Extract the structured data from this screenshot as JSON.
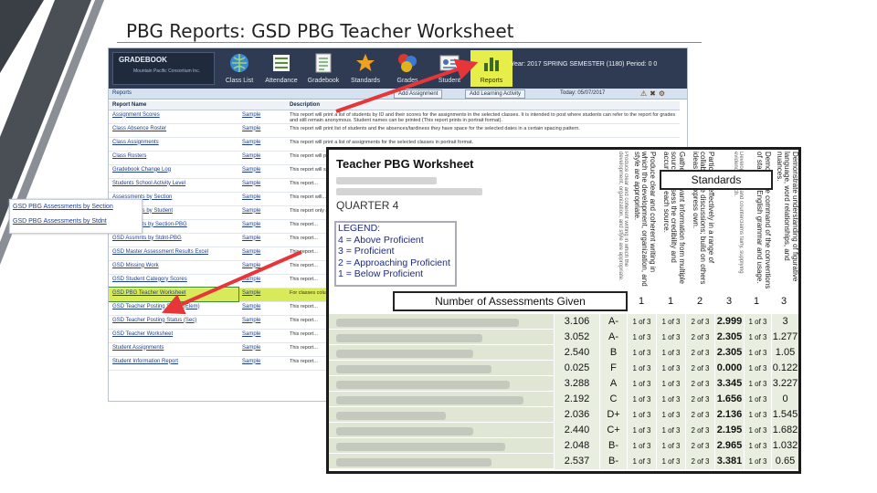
{
  "slide": {
    "title": "PBG Reports: GSD PBG Teacher Worksheet"
  },
  "colors": {
    "arrow": "#e6363a",
    "toolbar_active": "#e7ee4a",
    "row_highlight": "#d8ea5a",
    "legend_text": "#1e2b86",
    "toolbar_bg": "#2f3b52"
  },
  "gradebook": {
    "logo": "GRADEBOOK",
    "logo_sub": "Mountain Pacific\nConsortium Inc.",
    "toolbar": [
      {
        "label": "Class List",
        "icon": "globe-icon"
      },
      {
        "label": "Attendance",
        "icon": "attendance-icon"
      },
      {
        "label": "Gradebook",
        "icon": "gradebook-icon"
      },
      {
        "label": "Standards",
        "icon": "star-icon"
      },
      {
        "label": "Grades",
        "icon": "grades-icon"
      },
      {
        "label": "Student",
        "icon": "student-icon"
      },
      {
        "label": "Reports",
        "icon": "reports-icon"
      }
    ],
    "year_info": "Year: 2017 SPRING SEMESTER (1180) Period: 0 0",
    "subbar": {
      "reports_label": "Reports",
      "assignment_pill": "Add Assignment",
      "learning_pill": "Add Learning Activity",
      "date": "Today: 05/07/2017"
    },
    "table": {
      "headers": [
        "Report Name",
        "",
        "Description"
      ],
      "rows": [
        {
          "name": "Assignment Scores",
          "sample": "Sample",
          "desc": "This report will print a list of students by ID and their scores for the assignments in the selected classes. It is intended to post where students can refer to the report for grades and still remain anonymous. Student names can be printed (This report prints in portrait format)."
        },
        {
          "name": "Class Absence Roster",
          "sample": "Sample",
          "desc": "This report will print list of students and the absences/tardiness they have space for the selected dates in a certain spacing pattern."
        },
        {
          "name": "Class Assignments",
          "sample": "Sample",
          "desc": "This report will print a list of assignments for the selected classes in portrait format."
        },
        {
          "name": "Class Rosters",
          "sample": "Sample",
          "desc": "This report will print a list of students."
        },
        {
          "name": "Gradebook Change Log",
          "sample": "Sample",
          "desc": "This report will show changes (This report prints in landscape)."
        },
        {
          "name": "Students School Activity Level",
          "sample": "Sample",
          "desc": "This report..."
        },
        {
          "name": "Assessments by Section",
          "sample": "Sample",
          "desc": "This report will..."
        },
        {
          "name": "Assessments by Student",
          "sample": "Sample",
          "desc": "This report only assessment..."
        },
        {
          "name": "GSD Assmnts by Section-PBG",
          "sample": "Sample",
          "desc": "This report..."
        },
        {
          "name": "GSD Assmnts by Stdnt-PBG",
          "sample": "Sample",
          "desc": "This report..."
        },
        {
          "name": "GSD Master Assessment Results Excel",
          "sample": "Sample",
          "desc": "This report..."
        },
        {
          "name": "GSD Missing Work",
          "sample": "Sample",
          "desc": "This report..."
        },
        {
          "name": "GSD Student Category Scores",
          "sample": "Sample",
          "desc": "This report..."
        },
        {
          "name": "GSD PBG Teacher Worksheet",
          "sample": "Sample",
          "desc": "For classes column for..."
        },
        {
          "name": "GSD Teacher Posting Status (Elem)",
          "sample": "Sample",
          "desc": "This report..."
        },
        {
          "name": "GSD Teacher Posting Status (Sec)",
          "sample": "Sample",
          "desc": "This report..."
        },
        {
          "name": "GSD Teacher Worksheet",
          "sample": "Sample",
          "desc": "This report..."
        },
        {
          "name": "Student Assignments",
          "sample": "Sample",
          "desc": "This report..."
        },
        {
          "name": "Student Information Report",
          "sample": "Sample",
          "desc": "This report..."
        }
      ]
    }
  },
  "callout_left": {
    "items": [
      "GSD PBG Assessments by Section",
      "GSD PBG Assessments by Stdnt"
    ]
  },
  "worksheet": {
    "title": "Teacher PBG Worksheet",
    "quarter": "QUARTER 4",
    "legend": [
      "LEGEND:",
      "4 = Above Proficient",
      "3 = Proficient",
      "2 = Approaching Proficient",
      "1 = Below Proficient"
    ],
    "standards_label": "Standards",
    "assessments_label": "Number of Assessments Given",
    "standards": [
      "Produce clear and coherent writing in which the development, organization, and style are appropriate.",
      "Gather relevant information from multiple sources; assess the credibility and accuracy of each source.",
      "Participate effectively in a range of collaborative discussions; build on others ideas and express own.",
      "Develop claims and counterclaims fairly, supplying evidence for each.",
      "Apply knowledge of language to understand how it functions in different contexts.",
      "Demonstrate command of the conventions of standard English grammar and usage.",
      "Demonstrate understanding of figurative language, word relationships, and nuances."
    ],
    "levels": [
      "1",
      "1",
      "2",
      "3",
      "1",
      "3"
    ],
    "rows": [
      {
        "score": "3.106",
        "grade": "A-",
        "c1": "1 of 3",
        "c2": "1 of 3",
        "c3": "2 of 3",
        "v4": "2.999",
        "c5": "1 of 3",
        "v6": "3"
      },
      {
        "score": "3.052",
        "grade": "A-",
        "c1": "1 of 3",
        "c2": "1 of 3",
        "c3": "2 of 3",
        "v4": "2.305",
        "c5": "1 of 3",
        "v6": "1.277"
      },
      {
        "score": "2.540",
        "grade": "B",
        "c1": "1 of 3",
        "c2": "1 of 3",
        "c3": "2 of 3",
        "v4": "2.305",
        "c5": "1 of 3",
        "v6": "1.05"
      },
      {
        "score": "0.025",
        "grade": "F",
        "c1": "1 of 3",
        "c2": "1 of 3",
        "c3": "2 of 3",
        "v4": "0.000",
        "c5": "1 of 3",
        "v6": "0.122"
      },
      {
        "score": "3.288",
        "grade": "A",
        "c1": "1 of 3",
        "c2": "1 of 3",
        "c3": "2 of 3",
        "v4": "3.345",
        "c5": "1 of 3",
        "v6": "3.227"
      },
      {
        "score": "2.192",
        "grade": "C",
        "c1": "1 of 3",
        "c2": "1 of 3",
        "c3": "2 of 3",
        "v4": "1.656",
        "c5": "1 of 3",
        "v6": "0"
      },
      {
        "score": "2.036",
        "grade": "D+",
        "c1": "1 of 3",
        "c2": "1 of 3",
        "c3": "2 of 3",
        "v4": "2.136",
        "c5": "1 of 3",
        "v6": "1.545"
      },
      {
        "score": "2.440",
        "grade": "C+",
        "c1": "1 of 3",
        "c2": "1 of 3",
        "c3": "2 of 3",
        "v4": "2.195",
        "c5": "1 of 3",
        "v6": "1.682"
      },
      {
        "score": "2.048",
        "grade": "B-",
        "c1": "1 of 3",
        "c2": "1 of 3",
        "c3": "2 of 3",
        "v4": "2.965",
        "c5": "1 of 3",
        "v6": "1.032"
      },
      {
        "score": "2.537",
        "grade": "B-",
        "c1": "1 of 3",
        "c2": "1 of 3",
        "c3": "2 of 3",
        "v4": "3.381",
        "c5": "1 of 3",
        "v6": "0.65"
      }
    ]
  }
}
